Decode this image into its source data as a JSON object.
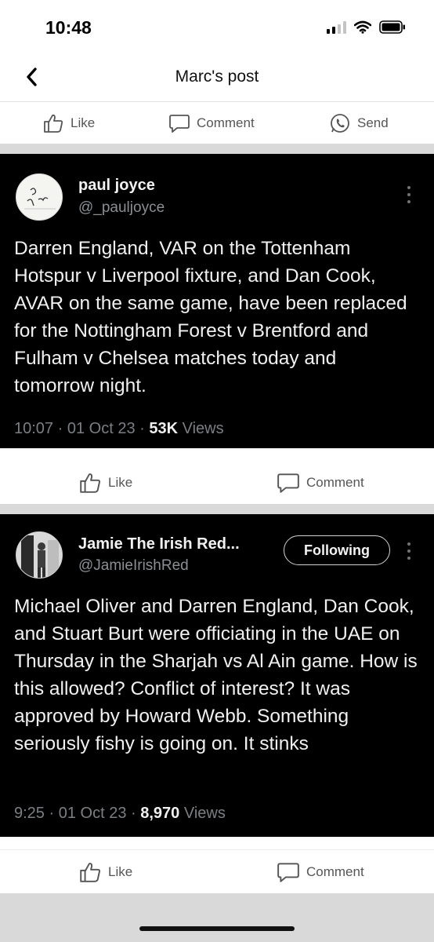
{
  "status": {
    "time": "10:48"
  },
  "nav": {
    "title": "Marc's post"
  },
  "top_actions": {
    "like": "Like",
    "comment": "Comment",
    "send": "Send"
  },
  "posts": [
    {
      "author": {
        "name": "paul joyce",
        "handle": "@_pauljoyce"
      },
      "text": "Darren England, VAR on the Tottenham Hotspur v Liverpool fixture, and Dan Cook, AVAR on the same game, have been replaced for the Nottingham Forest v Brentford and Fulham v Chelsea matches today and tomorrow night.",
      "meta": {
        "time": "10:07",
        "sep1": " · ",
        "date": "01 Oct 23",
        "sep2": " · ",
        "views_count": "53K",
        "views_label": " Views"
      },
      "actions": {
        "like": "Like",
        "comment": "Comment"
      }
    },
    {
      "author": {
        "name": "Jamie The Irish Red...",
        "handle": "@JamieIrishRed"
      },
      "follow_label": "Following",
      "text": "Michael Oliver and Darren England, Dan Cook, and Stuart Burt were officiating in the UAE on Thursday in the Sharjah vs Al Ain game. How is this allowed? Conflict of interest? It was approved by Howard Webb. Something seriously fishy is going on. It stinks",
      "meta": {
        "time": "9:25",
        "sep1": " · ",
        "date": "01 Oct 23",
        "sep2": " · ",
        "views_count": "8,970",
        "views_label": " Views"
      },
      "actions": {
        "like": "Like",
        "comment": "Comment"
      }
    }
  ],
  "icons": [
    "thumbs-up-icon",
    "comment-bubble-icon",
    "send-icon",
    "chevron-left-icon",
    "more-vertical-icon",
    "signal-icon",
    "wifi-icon",
    "battery-icon"
  ],
  "colors": {
    "card_bg": "#000000",
    "separator": "#d9d9d9",
    "action_text": "#555555",
    "handle": "#8b8f94"
  }
}
